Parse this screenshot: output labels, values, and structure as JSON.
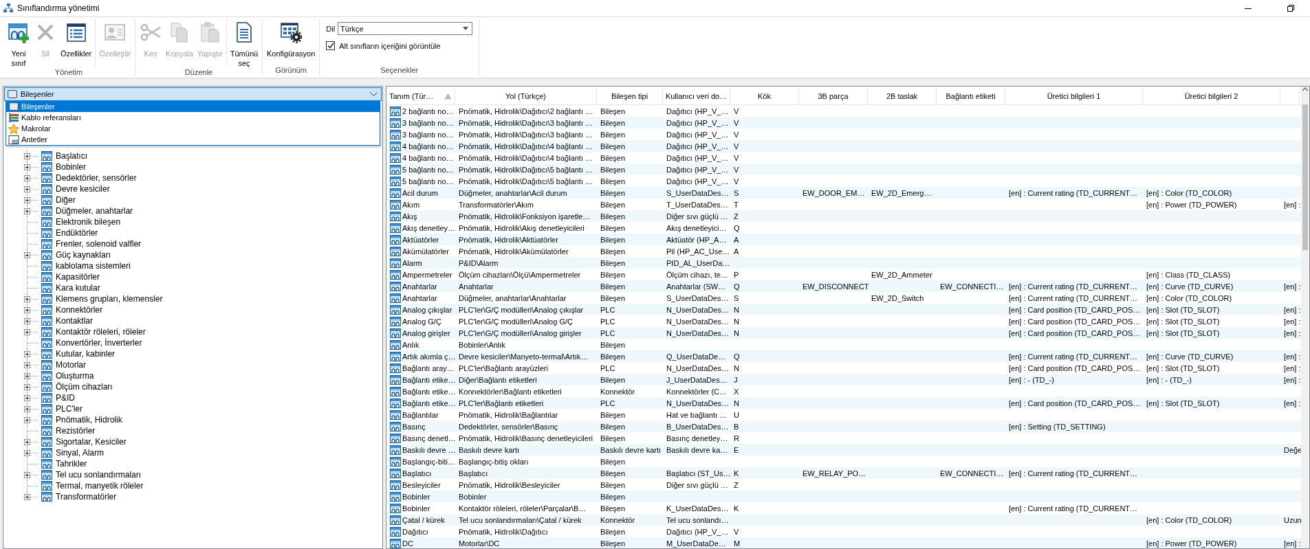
{
  "window": {
    "title": "Sınıflandırma yönetimi"
  },
  "ribbon": {
    "groups": [
      {
        "label": "Yönetim",
        "items": [
          {
            "kind": "new-class",
            "label": "Yeni sınıf",
            "disabled": false
          },
          {
            "kind": "delete",
            "label": "Sil",
            "disabled": true
          },
          {
            "kind": "properties",
            "label": "Özellikler",
            "disabled": false
          },
          {
            "kind": "separator"
          },
          {
            "kind": "customize",
            "label": "Özelleştir",
            "disabled": true
          }
        ]
      },
      {
        "label": "Düzenle",
        "items": [
          {
            "kind": "cut",
            "label": "Kes",
            "disabled": true
          },
          {
            "kind": "copy",
            "label": "Kopyala",
            "disabled": true
          },
          {
            "kind": "paste",
            "label": "Yapıştır",
            "disabled": true
          },
          {
            "kind": "separator"
          },
          {
            "kind": "select-all",
            "label": "Tümünü seç",
            "disabled": false
          }
        ]
      },
      {
        "label": "Görünüm",
        "items": [
          {
            "kind": "configuration",
            "label": "Konfigürasyon",
            "disabled": false
          }
        ]
      },
      {
        "label": "Seçenekler",
        "items": [
          {
            "kind": "combo",
            "label": "Dil",
            "value": "Türkçe"
          },
          {
            "kind": "checkbox",
            "label": "Alt sınıfların içeriğini görüntüle",
            "checked": true
          }
        ]
      }
    ]
  },
  "category_selector": {
    "value": "Bileşenler",
    "kind": "components",
    "expanded": true,
    "options": [
      {
        "label": "Bileşenler",
        "kind": "components",
        "selected": true
      },
      {
        "label": "Kablo referansları",
        "kind": "cables",
        "selected": false
      },
      {
        "label": "Makrolar",
        "kind": "macros",
        "selected": false
      },
      {
        "label": "Antetler",
        "kind": "title-blocks",
        "selected": false
      }
    ]
  },
  "tree": {
    "items": [
      {
        "label": "Başlatıcı",
        "expandable": true
      },
      {
        "label": "Bobinler",
        "expandable": true
      },
      {
        "label": "Dedektörler, sensörler",
        "expandable": true
      },
      {
        "label": "Devre kesiciler",
        "expandable": true
      },
      {
        "label": "Diğer",
        "expandable": true
      },
      {
        "label": "Düğmeler, anahtarlar",
        "expandable": true
      },
      {
        "label": "Elektronik bileşen",
        "expandable": false
      },
      {
        "label": "Endüktörler",
        "expandable": false
      },
      {
        "label": "Frenler, solenoid valfler",
        "expandable": false
      },
      {
        "label": "Güç kaynakları",
        "expandable": true
      },
      {
        "label": "kablolama sistemleri",
        "expandable": false
      },
      {
        "label": "Kapasitörler",
        "expandable": false
      },
      {
        "label": "Kara kutular",
        "expandable": false
      },
      {
        "label": "Klemens grupları, klemensler",
        "expandable": true
      },
      {
        "label": "Konnektörler",
        "expandable": true
      },
      {
        "label": "Kontaktlar",
        "expandable": true
      },
      {
        "label": "Kontaktör röleleri, röleler",
        "expandable": true
      },
      {
        "label": "Konvertörler, İnverterler",
        "expandable": false
      },
      {
        "label": "Kutular, kabinler",
        "expandable": true
      },
      {
        "label": "Motorlar",
        "expandable": true
      },
      {
        "label": "Oluşturma",
        "expandable": true
      },
      {
        "label": "Ölçüm cihazları",
        "expandable": true
      },
      {
        "label": "P&ID",
        "expandable": true
      },
      {
        "label": "PLC'ler",
        "expandable": true
      },
      {
        "label": "Pnömatik, Hidrolik",
        "expandable": true
      },
      {
        "label": "Rezistörler",
        "expandable": false
      },
      {
        "label": "Sigortalar, Kesiciler",
        "expandable": true
      },
      {
        "label": "Sinyal, Alarm",
        "expandable": true
      },
      {
        "label": "Tahrikler",
        "expandable": false
      },
      {
        "label": "Tel ucu sonlandırmaları",
        "expandable": true
      },
      {
        "label": "Termal, manyetik röleler",
        "expandable": false
      },
      {
        "label": "Transformatörler",
        "expandable": true
      }
    ]
  },
  "table": {
    "columns": [
      {
        "label": "Tanım (Tür…",
        "sorted": true
      },
      {
        "label": "Yol (Türkçe)",
        "sorted": false
      },
      {
        "label": "Bileşen tipi",
        "sorted": false
      },
      {
        "label": "Kullanıcı veri do…",
        "sorted": false
      },
      {
        "label": "Kök",
        "sorted": false
      },
      {
        "label": "3B parça",
        "sorted": false
      },
      {
        "label": "2B taslak",
        "sorted": false
      },
      {
        "label": "Bağlantı etiketi",
        "sorted": false
      },
      {
        "label": "Üretici bilgileri 1",
        "sorted": false
      },
      {
        "label": "Üretici bilgileri 2",
        "sorted": false
      },
      {
        "sorted": false
      }
    ],
    "rows": [
      {
        "definition": "2 bağlantı no…",
        "path": "Pnömatik, Hidrolik\\Dağıtıcı\\2 bağlantı …",
        "component_type": "Bileşen",
        "user_data": "Dağıtıcı (HP_V_…",
        "root": "V"
      },
      {
        "definition": "3 bağlantı no…",
        "path": "Pnömatik, Hidrolik\\Dağıtıcı\\3 bağlantı …",
        "component_type": "Bileşen",
        "user_data": "Dağıtıcı (HP_V_…",
        "root": "V"
      },
      {
        "definition": "3 bağlantı no…",
        "path": "Pnömatik, Hidrolik\\Dağıtıcı\\3 bağlantı …",
        "component_type": "Bileşen",
        "user_data": "Dağıtıcı (HP_V_…",
        "root": "V"
      },
      {
        "definition": "4 bağlantı no…",
        "path": "Pnömatik, Hidrolik\\Dağıtıcı\\4 bağlantı …",
        "component_type": "Bileşen",
        "user_data": "Dağıtıcı (HP_V_…",
        "root": "V"
      },
      {
        "definition": "4 bağlantı no…",
        "path": "Pnömatik, Hidrolik\\Dağıtıcı\\4 bağlantı …",
        "component_type": "Bileşen",
        "user_data": "Dağıtıcı (HP_V_…",
        "root": "V"
      },
      {
        "definition": "5 bağlantı no…",
        "path": "Pnömatik, Hidrolik\\Dağıtıcı\\5 bağlantı …",
        "component_type": "Bileşen",
        "user_data": "Dağıtıcı (HP_V_…",
        "root": "V"
      },
      {
        "definition": "5 bağlantı no…",
        "path": "Pnömatik, Hidrolik\\Dağıtıcı\\5 bağlantı …",
        "component_type": "Bileşen",
        "user_data": "Dağıtıcı (HP_V_…",
        "root": "V"
      },
      {
        "definition": "Acil durum",
        "path": "Düğmeler, anahtarlar\\Acil durum",
        "component_type": "Bileşen",
        "user_data": "S_UserDataDes…",
        "root": "S",
        "part_3d": "EW_DOOR_EM…",
        "draft_2d": "EW_2D_Emerg…",
        "manufacturer_1": "[en] : Current rating (TD_CURRENT…",
        "manufacturer_2": "[en] : Color (TD_COLOR)"
      },
      {
        "definition": "Akım",
        "path": "Transformatörler\\Akım",
        "component_type": "Bileşen",
        "user_data": "T_UserDataDes…",
        "root": "T",
        "manufacturer_2": "[en] : Power (TD_POWER)",
        "column_11": "[en] :"
      },
      {
        "definition": "Akış",
        "path": "Pnömatik, Hidrolik\\Fonksiyon işaretle…",
        "component_type": "Bileşen",
        "user_data": "Diğer sıvı güçlü …",
        "root": "Z"
      },
      {
        "definition": "Akış denetley…",
        "path": "Pnömatik, Hidrolik\\Akış denetleyicileri",
        "component_type": "Bileşen",
        "user_data": "Akış denetleyici…",
        "root": "Q"
      },
      {
        "definition": "Aktüatörler",
        "path": "Pnömatik, Hidrolik\\Aktüatörler",
        "component_type": "Bileşen",
        "user_data": "Aktüatör (HP_A…",
        "root": "A"
      },
      {
        "definition": "Akümülatörler",
        "path": "Pnömatik, Hidrolik\\Akümülatörler",
        "component_type": "Bileşen",
        "user_data": "Pil (HP_AC_Use…",
        "root": "A"
      },
      {
        "definition": "Alarm",
        "path": "P&ID\\Alarm",
        "component_type": "Bileşen",
        "user_data": "PID_AL_UserDa…"
      },
      {
        "definition": "Ampermetreler",
        "path": "Ölçüm cihazları\\Ölçü\\Ampermetreler",
        "component_type": "Bileşen",
        "user_data": "Ölçüm cihazı, te…",
        "root": "P",
        "draft_2d": "EW_2D_Ammeter",
        "manufacturer_2": "[en] : Class (TD_CLASS)"
      },
      {
        "definition": "Anahtarlar",
        "path": "Anahtarlar",
        "component_type": "Bileşen",
        "user_data": "Anahtarlar (SW…",
        "root": "Q",
        "part_3d": "EW_DISCONNECT",
        "connection_label": "EW_CONNECTI…",
        "manufacturer_1": "[en] : Current rating (TD_CURRENT…",
        "manufacturer_2": "[en] : Curve (TD_CURVE)",
        "column_11": "[en] :"
      },
      {
        "definition": "Anahtarlar",
        "path": "Düğmeler, anahtarlar\\Anahtarlar",
        "component_type": "Bileşen",
        "user_data": "S_UserDataDes…",
        "root": "S",
        "draft_2d": "EW_2D_Switch",
        "manufacturer_1": "[en] : Current rating (TD_CURRENT…",
        "manufacturer_2": "[en] : Color (TD_COLOR)"
      },
      {
        "definition": "Analog çıkışlar",
        "path": "PLC'ler\\G/Ç modülleri\\Analog çıkışlar",
        "component_type": "PLC",
        "user_data": "N_UserDataDes…",
        "root": "N",
        "manufacturer_1": "[en] : Card position (TD_CARD_POS…",
        "manufacturer_2": "[en] : Slot (TD_SLOT)",
        "column_11": "[en] :"
      },
      {
        "definition": "Analog G/Ç",
        "path": "PLC'ler\\G/Ç modülleri\\Analog G/Ç",
        "component_type": "PLC",
        "user_data": "N_UserDataDes…",
        "root": "N",
        "manufacturer_1": "[en] : Card position (TD_CARD_POS…",
        "manufacturer_2": "[en] : Slot (TD_SLOT)",
        "column_11": "[en] :"
      },
      {
        "definition": "Analog girişler",
        "path": "PLC'ler\\G/Ç modülleri\\Analog girişler",
        "component_type": "PLC",
        "user_data": "N_UserDataDes…",
        "root": "N",
        "manufacturer_1": "[en] : Card position (TD_CARD_POS…",
        "manufacturer_2": "[en] : Slot (TD_SLOT)",
        "column_11": "[en] :"
      },
      {
        "definition": "Anlık",
        "path": "Bobinler\\Anlık",
        "component_type": "Bileşen"
      },
      {
        "definition": "Artık akımla ç…",
        "path": "Devre kesiciler\\Manyeto-termal\\Artık…",
        "component_type": "Bileşen",
        "user_data": "Q_UserDataDe…",
        "root": "Q",
        "manufacturer_1": "[en] : Current rating (TD_CURRENT…",
        "manufacturer_2": "[en] : Curve (TD_CURVE)",
        "column_11": "[en] :"
      },
      {
        "definition": "Bağlantı aray…",
        "path": "PLC'ler\\Bağlantı arayüzleri",
        "component_type": "PLC",
        "user_data": "N_UserDataDes…",
        "root": "N",
        "manufacturer_1": "[en] : Card position (TD_CARD_POS…",
        "manufacturer_2": "[en] : Slot (TD_SLOT)",
        "column_11": "[en] :"
      },
      {
        "definition": "Bağlantı etike…",
        "path": "Diğer\\Bağlantı etiketleri",
        "component_type": "Bileşen",
        "user_data": "J_UserDataDes…",
        "root": "J",
        "manufacturer_1": "[en] : - (TD_-)",
        "manufacturer_2": "[en] : - (TD_-)",
        "column_11": "[en] :"
      },
      {
        "definition": "Bağlantı etike…",
        "path": "Konnektörler\\Bağlantı etiketleri",
        "component_type": "Konnektör",
        "user_data": "Konnektörler (C…",
        "root": "X"
      },
      {
        "definition": "Bağlantı etike…",
        "path": "PLC'ler\\Bağlantı etiketleri",
        "component_type": "PLC",
        "user_data": "N_UserDataDes…",
        "root": "N",
        "manufacturer_1": "[en] : Card position (TD_CARD_POS…",
        "manufacturer_2": "[en] : Slot (TD_SLOT)",
        "column_11": "[en] :"
      },
      {
        "definition": "Bağlantılar",
        "path": "Pnömatik, Hidrolik\\Bağlantılar",
        "component_type": "Bileşen",
        "user_data": "Hat ve bağlantı …",
        "root": "U"
      },
      {
        "definition": "Basınç",
        "path": "Dedektörler, sensörler\\Basınç",
        "component_type": "Bileşen",
        "user_data": "B_UserDataDes…",
        "root": "B",
        "manufacturer_1": "[en] : Setting (TD_SETTING)"
      },
      {
        "definition": "Basınç denetl…",
        "path": "Pnömatik, Hidrolik\\Basınç denetleyicileri",
        "component_type": "Bileşen",
        "user_data": "Basınç denetley…",
        "root": "R"
      },
      {
        "definition": "Baskılı devre …",
        "path": "Baskılı devre kartı",
        "component_type": "Baskılı devre kartı",
        "user_data": "Baskılı devre ka…",
        "root": "E",
        "column_11": "Değe"
      },
      {
        "definition": "Başlangıç-biti…",
        "path": "Başlangıç-bitiş okları",
        "component_type": "Bileşen"
      },
      {
        "definition": "Başlatıcı",
        "path": "Başlatıcı",
        "component_type": "Bileşen",
        "user_data": "Başlatıcı (ST_Us…",
        "root": "K",
        "part_3d": "EW_RELAY_PO…",
        "connection_label": "EW_CONNECTI…",
        "manufacturer_1": "[en] : Current rating (TD_CURRENT…"
      },
      {
        "definition": "Besleyiciler",
        "path": "Pnömatik, Hidrolik\\Besleyiciler",
        "component_type": "Bileşen",
        "user_data": "Diğer sıvı güçlü …",
        "root": "Z"
      },
      {
        "definition": "Bobinler",
        "path": "Bobinler",
        "component_type": "Bileşen"
      },
      {
        "definition": "Bobinler",
        "path": "Kontaktör röleleri, röleler\\Parçalar\\B…",
        "component_type": "Bileşen",
        "user_data": "K_UserDataDes…",
        "root": "K",
        "manufacturer_1": "[en] : Current rating (TD_CURRENT…"
      },
      {
        "definition": "Çatal / kürek",
        "path": "Tel ucu sonlandırmaları\\Çatal / kürek",
        "component_type": "Konnektör",
        "user_data": "Tel ucu sonlandı…",
        "manufacturer_2": "[en] : Color (TD_COLOR)",
        "column_11": "Uzun"
      },
      {
        "definition": "Dağıtıcı",
        "path": "Pnömatik, Hidrolik\\Dağıtıcı",
        "component_type": "Bileşen",
        "user_data": "Dağıtıcı (HP_V_…",
        "root": "V"
      },
      {
        "definition": "DC",
        "path": "Motorlar\\DC",
        "component_type": "Bileşen",
        "user_data": "M_UserDataDe…",
        "root": "M",
        "manufacturer_2": "[en] : Power (TD_POWER)",
        "column_11": "[en] :"
      }
    ]
  }
}
